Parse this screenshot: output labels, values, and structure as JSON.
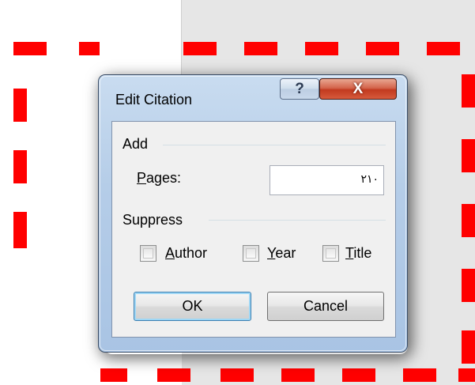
{
  "dialog": {
    "title": "Edit Citation",
    "help_label": "?",
    "close_label": "X"
  },
  "add_group": {
    "label": "Add",
    "pages": {
      "label_first": "P",
      "label_rest": "ages:",
      "value": "٢١٠"
    }
  },
  "suppress_group": {
    "label": "Suppress",
    "author": {
      "first": "A",
      "rest": "uthor"
    },
    "year": {
      "first": "Y",
      "rest": "ear"
    },
    "title": {
      "first": "T",
      "rest": "itle"
    }
  },
  "buttons": {
    "ok": "OK",
    "cancel": "Cancel"
  },
  "colors": {
    "annotation": "#ff0000",
    "close_button": "#c23a1f"
  }
}
